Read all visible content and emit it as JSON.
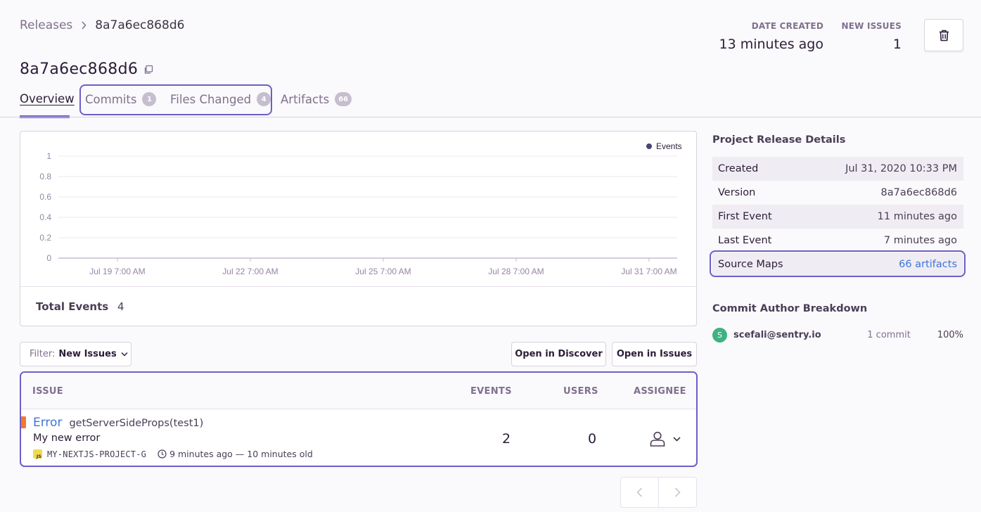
{
  "breadcrumb": {
    "parent": "Releases",
    "current": "8a7a6ec868d6"
  },
  "header": {
    "title": "8a7a6ec868d6",
    "date_created_label": "DATE CREATED",
    "date_created_value": "13 minutes ago",
    "new_issues_label": "NEW ISSUES",
    "new_issues_value": "1"
  },
  "tabs": [
    {
      "label": "Overview",
      "active": true
    },
    {
      "label": "Commits",
      "count": "1"
    },
    {
      "label": "Files Changed",
      "count": "4"
    },
    {
      "label": "Artifacts",
      "count": "66"
    }
  ],
  "chart_data": {
    "type": "bar",
    "categories": [
      "Jul 19 7:00 AM",
      "Jul 22 7:00 AM",
      "Jul 25 7:00 AM",
      "Jul 28 7:00 AM",
      "Jul 31 7:00 AM"
    ],
    "series": [
      {
        "name": "Events",
        "values": [
          0,
          0,
          0,
          0,
          0
        ]
      }
    ],
    "ylim": [
      0,
      1
    ],
    "yticks": [
      "1",
      "0.8",
      "0.6",
      "0.4",
      "0.2",
      "0"
    ],
    "legend_position": "top-right",
    "grid": true,
    "colors": {
      "series": "#444674",
      "axis": "#c6becf",
      "grid": "#ebe7ef",
      "tick": "#9585a3"
    }
  },
  "total_events": {
    "label": "Total Events",
    "value": "4"
  },
  "filter": {
    "prefix": "Filter:",
    "value": "New Issues"
  },
  "buttons": {
    "open_discover": "Open in Discover",
    "open_issues": "Open in Issues"
  },
  "issues_table": {
    "headers": {
      "issue": "ISSUE",
      "events": "EVENTS",
      "users": "USERS",
      "assignee": "ASSIGNEE"
    },
    "rows": [
      {
        "type": "Error",
        "culprit": "getServerSideProps(test1)",
        "message": "My new error",
        "platform_badge": "JS",
        "short_id": "MY-NEXTJS-PROJECT-G",
        "times": "9 minutes ago — 10 minutes old",
        "events": "2",
        "users": "0",
        "level_color": "#f2792d"
      }
    ]
  },
  "sidebar": {
    "details_heading": "Project Release Details",
    "details": [
      {
        "key": "Created",
        "value": "Jul 31, 2020 10:33 PM"
      },
      {
        "key": "Version",
        "value": "8a7a6ec868d6"
      },
      {
        "key": "First Event",
        "value": "11 minutes ago"
      },
      {
        "key": "Last Event",
        "value": "7 minutes ago"
      },
      {
        "key": "Source Maps",
        "value": "66 artifacts"
      }
    ],
    "authors_heading": "Commit Author Breakdown",
    "authors": [
      {
        "initial": "S",
        "email": "scefali@sentry.io",
        "commits": "1 commit",
        "percent": "100%"
      }
    ]
  },
  "colors": {
    "accent": "#6c5fc7",
    "link": "#3d74db",
    "avatar": "#3fb184"
  }
}
